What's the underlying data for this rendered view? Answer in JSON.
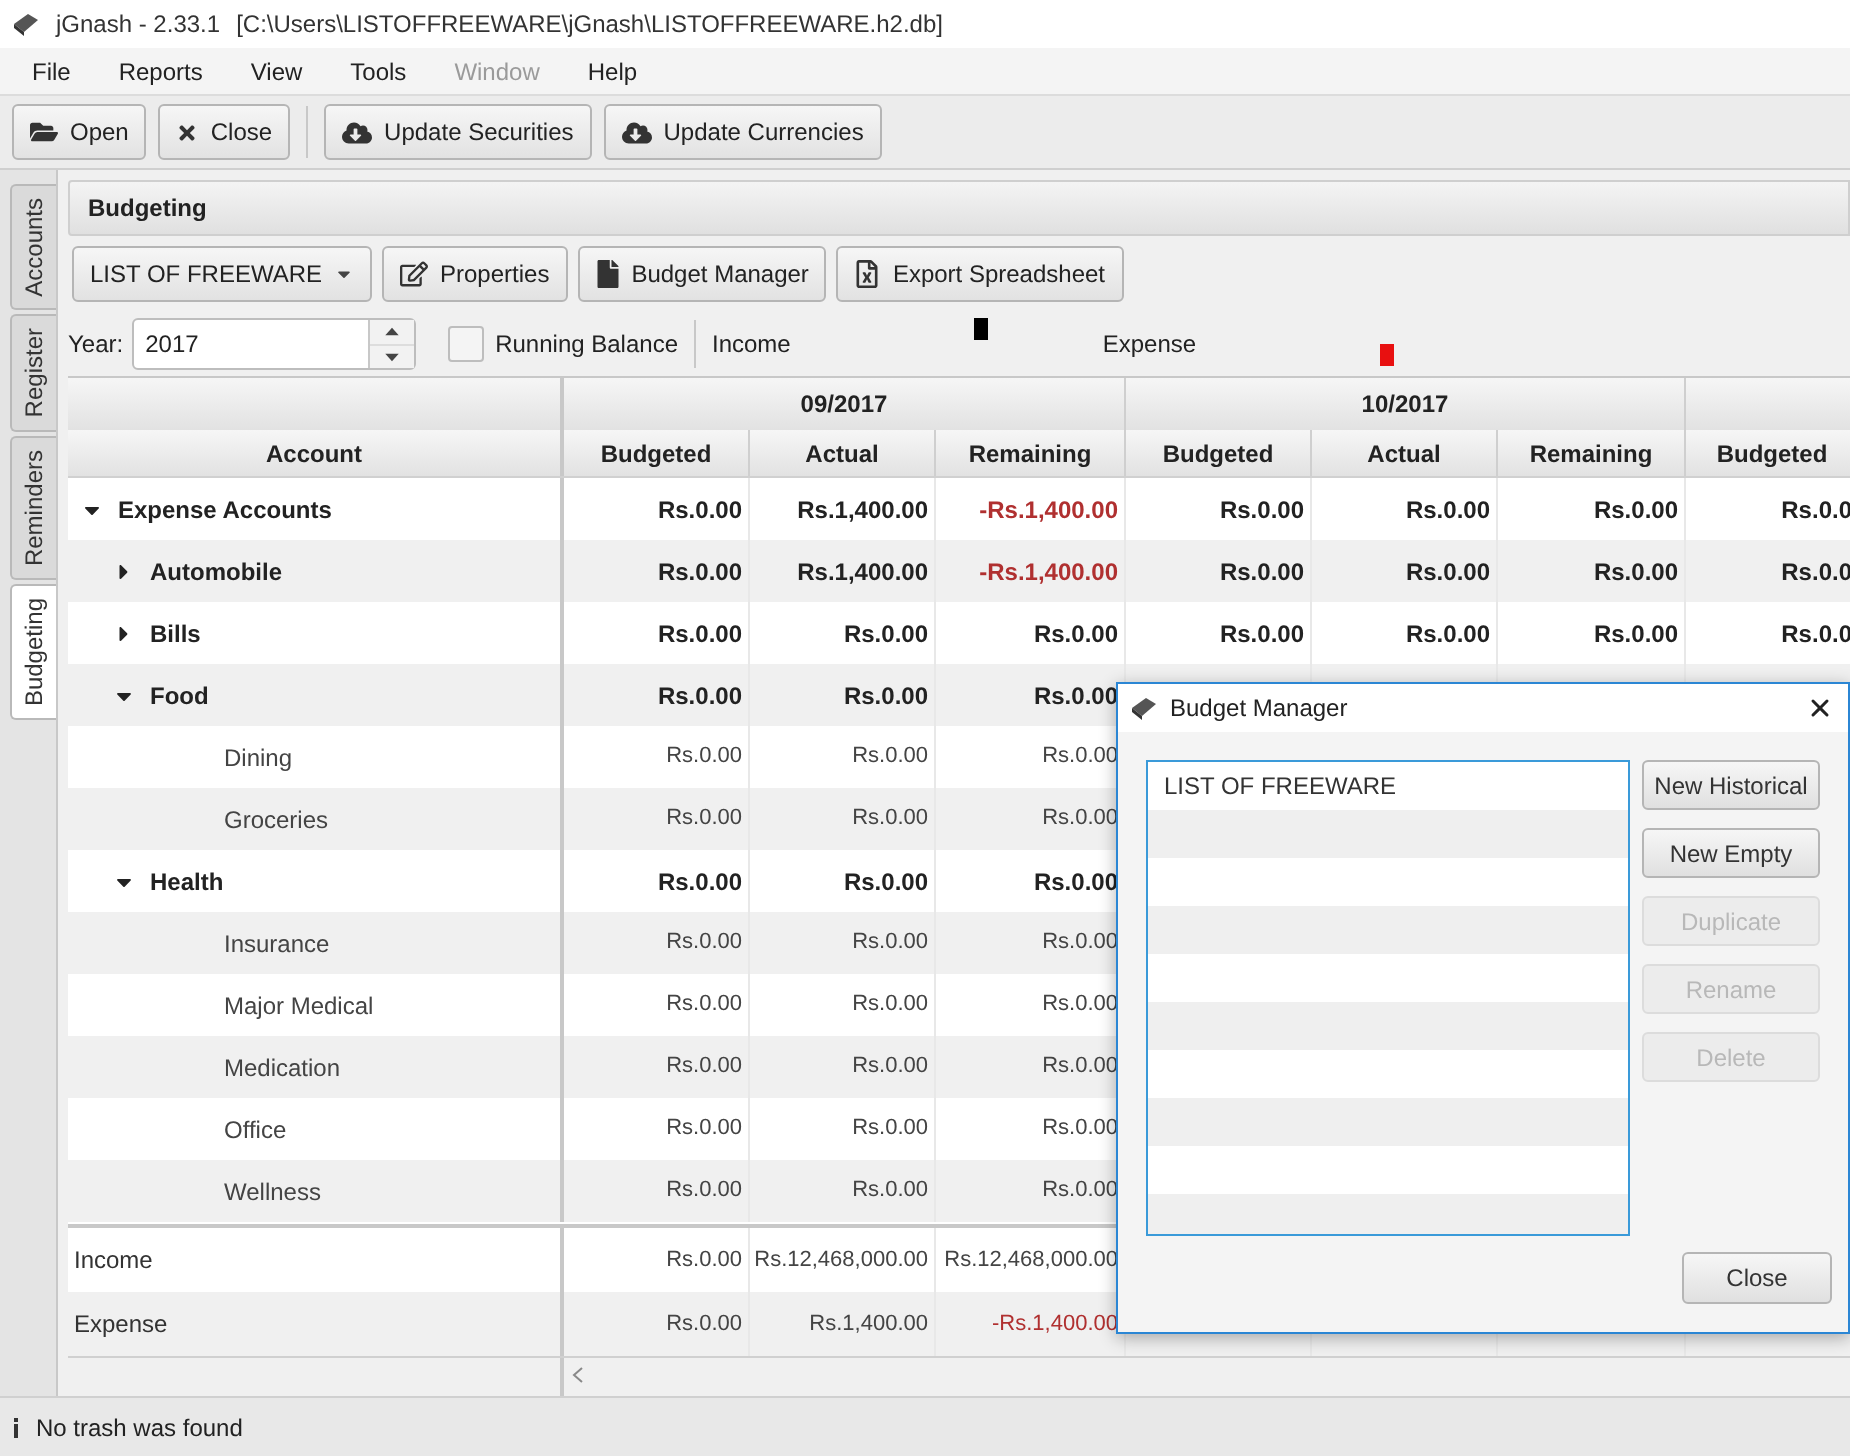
{
  "window": {
    "title": "jGnash - 2.33.1",
    "path": "[C:\\Users\\LISTOFFREEWARE\\jGnash\\LISTOFFREEWARE.h2.db]"
  },
  "menu": [
    {
      "label": "File",
      "disabled": false
    },
    {
      "label": "Reports",
      "disabled": false
    },
    {
      "label": "View",
      "disabled": false
    },
    {
      "label": "Tools",
      "disabled": false
    },
    {
      "label": "Window",
      "disabled": true
    },
    {
      "label": "Help",
      "disabled": false
    }
  ],
  "toolbar": [
    {
      "label": "Open"
    },
    {
      "label": "Close"
    },
    {
      "label": "Update Securities"
    },
    {
      "label": "Update Currencies"
    }
  ],
  "side_tabs": [
    {
      "label": "Accounts",
      "selected": false
    },
    {
      "label": "Register",
      "selected": false
    },
    {
      "label": "Reminders",
      "selected": false
    },
    {
      "label": "Budgeting",
      "selected": true
    }
  ],
  "panel_title": "Budgeting",
  "budget_select": "LIST OF FREEWARE",
  "budget_buttons": [
    {
      "label": "Properties"
    },
    {
      "label": "Budget Manager"
    },
    {
      "label": "Export Spreadsheet"
    }
  ],
  "year": {
    "label": "Year:",
    "value": "2017"
  },
  "running_balance": {
    "label": "Running Balance",
    "checked": false
  },
  "legend": [
    {
      "label": "Income",
      "color": "#000000"
    },
    {
      "label": "Expense",
      "color": "#e81010"
    }
  ],
  "table": {
    "account_header": "Account",
    "periods": [
      {
        "label": "09/2017",
        "columns": [
          "Budgeted",
          "Actual",
          "Remaining"
        ]
      },
      {
        "label": "10/2017",
        "columns": [
          "Budgeted",
          "Actual",
          "Remaining"
        ]
      },
      {
        "columns": [
          "Budgeted"
        ]
      }
    ],
    "rows": [
      {
        "name": "Expense Accounts",
        "kind": "group",
        "expanded": true,
        "cells": [
          {
            "text": "Rs.0.00",
            "negative": false
          },
          {
            "text": "Rs.1,400.00",
            "negative": false
          },
          {
            "text": "-Rs.1,400.00",
            "negative": true
          },
          {
            "text": "Rs.0.00",
            "negative": false
          },
          {
            "text": "Rs.0.00",
            "negative": false
          },
          {
            "text": "Rs.0.00",
            "negative": false
          },
          {
            "text": "Rs.0.0",
            "negative": false
          }
        ],
        "children": [
          {
            "name": "Automobile",
            "kind": "group",
            "expanded": false,
            "cells": [
              {
                "text": "Rs.0.00",
                "negative": false
              },
              {
                "text": "Rs.1,400.00",
                "negative": false
              },
              {
                "text": "-Rs.1,400.00",
                "negative": true
              },
              {
                "text": "Rs.0.00",
                "negative": false
              },
              {
                "text": "Rs.0.00",
                "negative": false
              },
              {
                "text": "Rs.0.00",
                "negative": false
              },
              {
                "text": "Rs.0.0",
                "negative": false
              }
            ]
          },
          {
            "name": "Bills",
            "kind": "group",
            "expanded": false,
            "cells": [
              {
                "text": "Rs.0.00",
                "negative": false
              },
              {
                "text": "Rs.0.00",
                "negative": false
              },
              {
                "text": "Rs.0.00",
                "negative": false
              },
              {
                "text": "Rs.0.00",
                "negative": false
              },
              {
                "text": "Rs.0.00",
                "negative": false
              },
              {
                "text": "Rs.0.00",
                "negative": false
              },
              {
                "text": "Rs.0.0",
                "negative": false
              }
            ]
          },
          {
            "name": "Food",
            "kind": "group",
            "expanded": true,
            "cells": [
              {
                "text": "Rs.0.00",
                "negative": false
              },
              {
                "text": "Rs.0.00",
                "negative": false
              },
              {
                "text": "Rs.0.00",
                "negative": false
              }
            ],
            "children": [
              {
                "name": "Dining",
                "kind": "account",
                "cells": [
                  {
                    "text": "Rs.0.00",
                    "negative": false
                  },
                  {
                    "text": "Rs.0.00",
                    "negative": false
                  },
                  {
                    "text": "Rs.0.00",
                    "negative": false
                  }
                ]
              },
              {
                "name": "Groceries",
                "kind": "account",
                "cells": [
                  {
                    "text": "Rs.0.00",
                    "negative": false
                  },
                  {
                    "text": "Rs.0.00",
                    "negative": false
                  },
                  {
                    "text": "Rs.0.00",
                    "negative": false
                  }
                ]
              }
            ]
          },
          {
            "name": "Health",
            "kind": "group",
            "expanded": true,
            "cells": [
              {
                "text": "Rs.0.00",
                "negative": false
              },
              {
                "text": "Rs.0.00",
                "negative": false
              },
              {
                "text": "Rs.0.00",
                "negative": false
              }
            ],
            "children": [
              {
                "name": "Insurance",
                "kind": "account",
                "cells": [
                  {
                    "text": "Rs.0.00",
                    "negative": false
                  },
                  {
                    "text": "Rs.0.00",
                    "negative": false
                  },
                  {
                    "text": "Rs.0.00",
                    "negative": false
                  }
                ]
              },
              {
                "name": "Major Medical",
                "kind": "account",
                "cells": [
                  {
                    "text": "Rs.0.00",
                    "negative": false
                  },
                  {
                    "text": "Rs.0.00",
                    "negative": false
                  },
                  {
                    "text": "Rs.0.00",
                    "negative": false
                  }
                ]
              },
              {
                "name": "Medication",
                "kind": "account",
                "cells": [
                  {
                    "text": "Rs.0.00",
                    "negative": false
                  },
                  {
                    "text": "Rs.0.00",
                    "negative": false
                  },
                  {
                    "text": "Rs.0.00",
                    "negative": false
                  }
                ]
              },
              {
                "name": "Office",
                "kind": "account",
                "cells": [
                  {
                    "text": "Rs.0.00",
                    "negative": false
                  },
                  {
                    "text": "Rs.0.00",
                    "negative": false
                  },
                  {
                    "text": "Rs.0.00",
                    "negative": false
                  }
                ]
              },
              {
                "name": "Wellness",
                "kind": "account",
                "cells": [
                  {
                    "text": "Rs.0.00",
                    "negative": false
                  },
                  {
                    "text": "Rs.0.00",
                    "negative": false
                  },
                  {
                    "text": "Rs.0.00",
                    "negative": false
                  }
                ]
              }
            ]
          }
        ]
      }
    ],
    "totals": [
      {
        "name": "Income",
        "cells": [
          {
            "text": "Rs.0.00",
            "negative": false
          },
          {
            "text": "Rs.12,468,000.00",
            "negative": false
          },
          {
            "text": "Rs.12,468,000.00",
            "negative": false
          }
        ]
      },
      {
        "name": "Expense",
        "cells": [
          {
            "text": "Rs.0.00",
            "negative": false
          },
          {
            "text": "Rs.1,400.00",
            "negative": false
          },
          {
            "text": "-Rs.1,400.00",
            "negative": true
          }
        ]
      }
    ]
  },
  "dialog": {
    "title": "Budget Manager",
    "items": [
      {
        "label": "LIST OF FREEWARE",
        "selected": false
      }
    ],
    "buttons": [
      {
        "label": "New Historical",
        "disabled": false
      },
      {
        "label": "New Empty",
        "disabled": false
      },
      {
        "label": "Duplicate",
        "disabled": true
      },
      {
        "label": "Rename",
        "disabled": true
      },
      {
        "label": "Delete",
        "disabled": true
      }
    ],
    "close": "Close"
  },
  "status_bar": {
    "text": "No trash was found"
  }
}
